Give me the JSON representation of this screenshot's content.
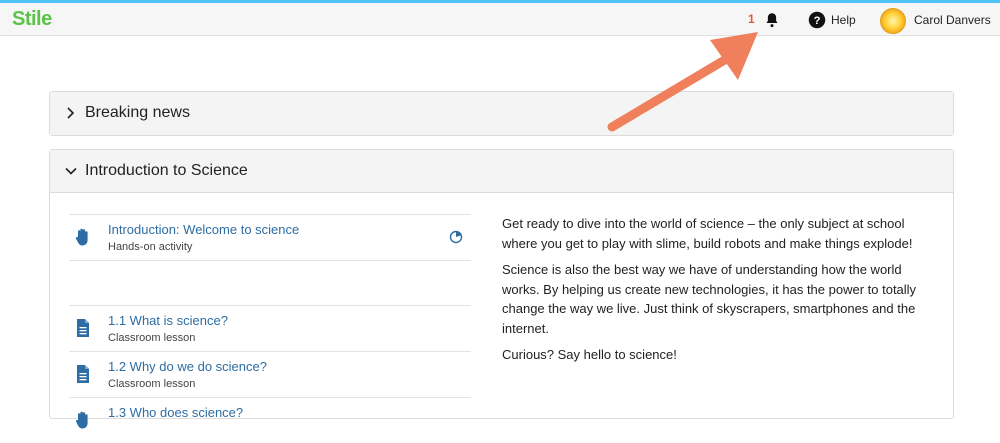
{
  "header": {
    "logo": "Stile",
    "notification_count": "1",
    "help_label": "Help",
    "user_name": "Carol Danvers"
  },
  "sections": [
    {
      "title": "Breaking news",
      "expanded": false
    },
    {
      "title": "Introduction to Science",
      "expanded": true
    }
  ],
  "lessons": [
    {
      "title": "Introduction: Welcome to science",
      "subtitle": "Hands-on activity",
      "icon": "hand-icon"
    },
    {
      "title": "1.1 What is science?",
      "subtitle": "Classroom lesson",
      "icon": "document-icon"
    },
    {
      "title": "1.2 Why do we do science?",
      "subtitle": "Classroom lesson",
      "icon": "document-icon"
    },
    {
      "title": "1.3 Who does science?",
      "subtitle": "",
      "icon": "hand-icon"
    }
  ],
  "description": [
    "Get ready to dive into the world of science – the only subject at school where you get to play with slime, build robots and make things explode!",
    "Science is also the best way we have of understanding how the world works. By helping us create new technologies, it has the power to totally change the way we live. Just think of skyscrapers, smartphones and the internet.",
    "Curious? Say hello to science!"
  ],
  "colors": {
    "brand": "#5cc24a",
    "link": "#2d6da3",
    "notification": "#e8553a",
    "annotation_arrow": "#f07f5c"
  }
}
